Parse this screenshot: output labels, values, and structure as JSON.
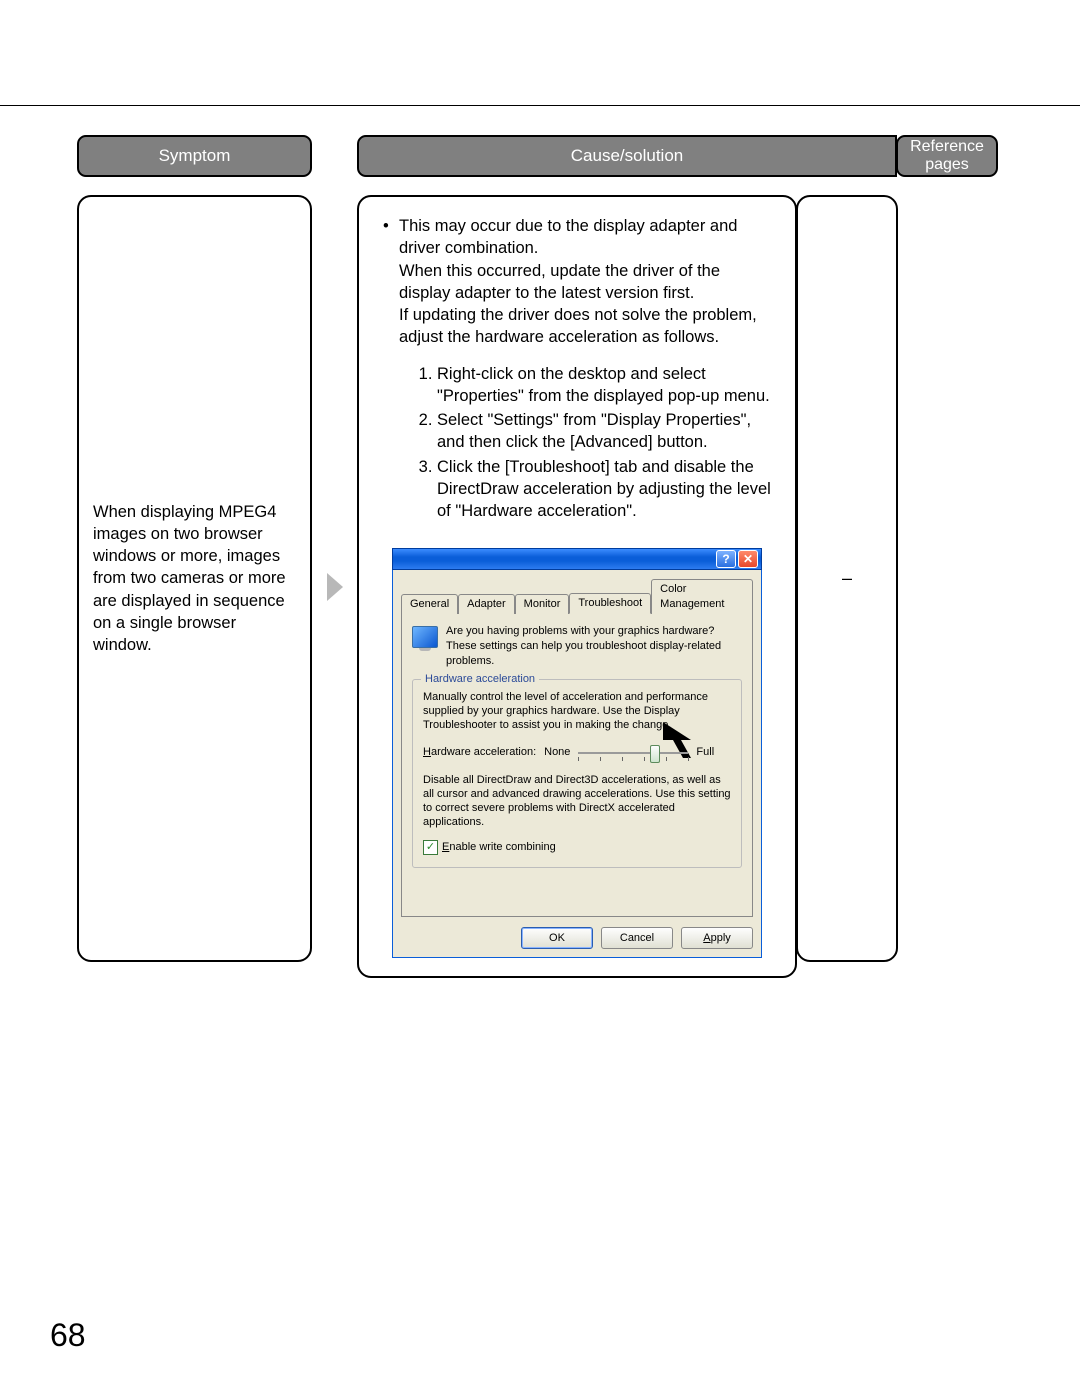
{
  "page_number": "68",
  "headers": {
    "symptom": "Symptom",
    "cause": "Cause/solution",
    "reference": "Reference pages"
  },
  "row": {
    "symptom": "When displaying MPEG4 images on two browser windows or more, images from two cameras or more are displayed in sequence on a single browser window.",
    "reference": "–",
    "cause": {
      "bullet_intro": "This may occur due to the display adapter and driver combination.",
      "bullet_line2": "When this occurred, update the driver of the display adapter to the latest version first.",
      "bullet_line3": "If updating the driver does not solve the problem, adjust the hardware acceleration as follows.",
      "steps": [
        "Right-click on the desktop and select \"Properties\" from the displayed pop-up menu.",
        "Select \"Settings\" from \"Display Properties\", and then click the [Advanced] button.",
        "Click the [Troubleshoot] tab and disable the DirectDraw acceleration by adjusting the level of \"Hardware acceleration\"."
      ]
    }
  },
  "dialog": {
    "tabs": {
      "general": "General",
      "adapter": "Adapter",
      "monitor": "Monitor",
      "troubleshoot": "Troubleshoot",
      "color": "Color Management"
    },
    "intro": "Are you having problems with your graphics hardware? These settings can help you troubleshoot display-related problems.",
    "group_legend": "Hardware acceleration",
    "group_text": "Manually control the level of acceleration and performance supplied by your graphics hardware. Use the Display Troubleshooter to assist you in making the change.",
    "slider_label": "Hardware acceleration:",
    "slider_none": "None",
    "slider_full": "Full",
    "slider_desc": "Disable all DirectDraw and Direct3D accelerations, as well as all cursor and advanced drawing accelerations. Use this setting to correct severe problems with DirectX accelerated applications.",
    "checkbox_label": "Enable write combining",
    "buttons": {
      "ok": "OK",
      "cancel": "Cancel",
      "apply": "Apply"
    },
    "titlebar": {
      "help": "?",
      "close": "✕"
    }
  }
}
